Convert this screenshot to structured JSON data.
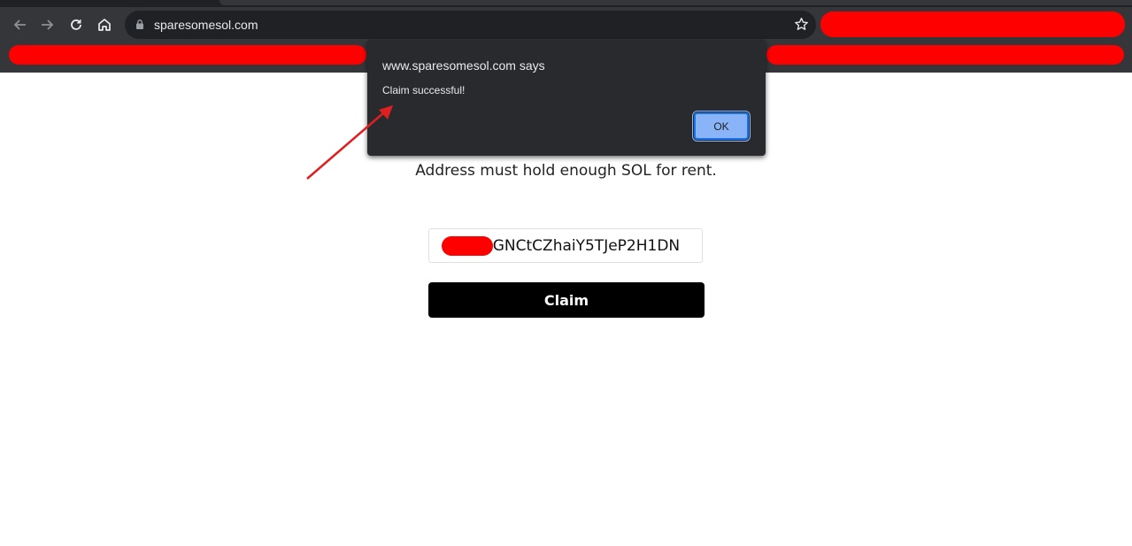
{
  "browser": {
    "url": "sparesomesol.com",
    "nav_icons": [
      "back-icon",
      "forward-icon",
      "reload-icon",
      "home-icon"
    ],
    "lock_icon": "lock-icon",
    "bookmark_icon": "star-icon",
    "redaction_color": "#ff0000"
  },
  "dialog": {
    "title": "www.sparesomesol.com says",
    "message": "Claim successful!",
    "ok_label": "OK"
  },
  "page": {
    "hint": "Address must hold enough SOL for rent.",
    "address_value": "TUzGNCtCZhaiY5TJeP2H1DN",
    "claim_label": "Claim"
  },
  "annotation": {
    "arrow_color": "#e02020"
  }
}
